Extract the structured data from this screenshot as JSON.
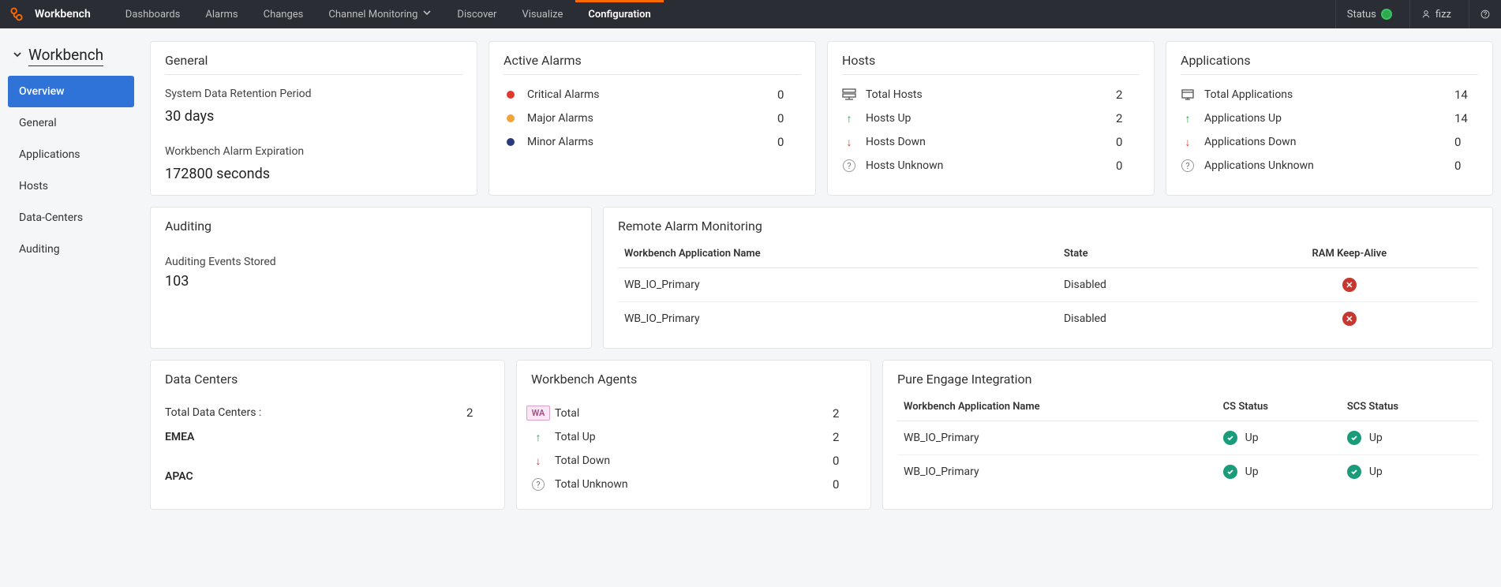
{
  "topbar": {
    "brand": "Workbench",
    "nav": {
      "dashboards": "Dashboards",
      "alarms": "Alarms",
      "changes": "Changes",
      "channel_monitoring": "Channel Monitoring",
      "discover": "Discover",
      "visualize": "Visualize",
      "configuration": "Configuration"
    },
    "status_label": "Status",
    "user": "fizz"
  },
  "sidebar": {
    "title": "Workbench",
    "items": {
      "overview": "Overview",
      "general": "General",
      "applications": "Applications",
      "hosts": "Hosts",
      "data_centers": "Data-Centers",
      "auditing": "Auditing"
    }
  },
  "general_card": {
    "title": "General",
    "retention_label": "System Data Retention Period",
    "retention_value": "30 days",
    "alarm_exp_label": "Workbench Alarm Expiration",
    "alarm_exp_value": "172800 seconds"
  },
  "alarms_card": {
    "title": "Active Alarms",
    "rows": {
      "critical": {
        "label": "Critical Alarms",
        "value": "0"
      },
      "major": {
        "label": "Major Alarms",
        "value": "0"
      },
      "minor": {
        "label": "Minor Alarms",
        "value": "0"
      }
    }
  },
  "hosts_card": {
    "title": "Hosts",
    "rows": {
      "total": {
        "label": "Total Hosts",
        "value": "2"
      },
      "up": {
        "label": "Hosts Up",
        "value": "2"
      },
      "down": {
        "label": "Hosts Down",
        "value": "0"
      },
      "unknown": {
        "label": "Hosts Unknown",
        "value": "0"
      }
    }
  },
  "apps_card": {
    "title": "Applications",
    "rows": {
      "total": {
        "label": "Total Applications",
        "value": "14"
      },
      "up": {
        "label": "Applications Up",
        "value": "14"
      },
      "down": {
        "label": "Applications Down",
        "value": "0"
      },
      "unknown": {
        "label": "Applications Unknown",
        "value": "0"
      }
    }
  },
  "auditing_card": {
    "title": "Auditing",
    "label": "Auditing Events Stored",
    "value": "103"
  },
  "ram_card": {
    "title": "Remote Alarm Monitoring",
    "headers": {
      "app": "Workbench Application Name",
      "state": "State",
      "keepalive": "RAM Keep-Alive"
    },
    "rows": [
      {
        "app": "WB_IO_Primary",
        "state": "Disabled"
      },
      {
        "app": "WB_IO_Primary",
        "state": "Disabled"
      }
    ]
  },
  "dc_card": {
    "title": "Data Centers",
    "total_label": "Total Data Centers :",
    "total_value": "2",
    "regions": {
      "emea": "EMEA",
      "apac": "APAC"
    }
  },
  "agents_card": {
    "title": "Workbench Agents",
    "badge": "WA",
    "rows": {
      "total": {
        "label": "Total",
        "value": "2"
      },
      "up": {
        "label": "Total Up",
        "value": "2"
      },
      "down": {
        "label": "Total Down",
        "value": "0"
      },
      "unknown": {
        "label": "Total Unknown",
        "value": "0"
      }
    }
  },
  "pei_card": {
    "title": "Pure Engage Integration",
    "headers": {
      "app": "Workbench Application Name",
      "cs": "CS Status",
      "scs": "SCS Status"
    },
    "up_label": "Up",
    "rows": [
      {
        "app": "WB_IO_Primary"
      },
      {
        "app": "WB_IO_Primary"
      }
    ]
  }
}
